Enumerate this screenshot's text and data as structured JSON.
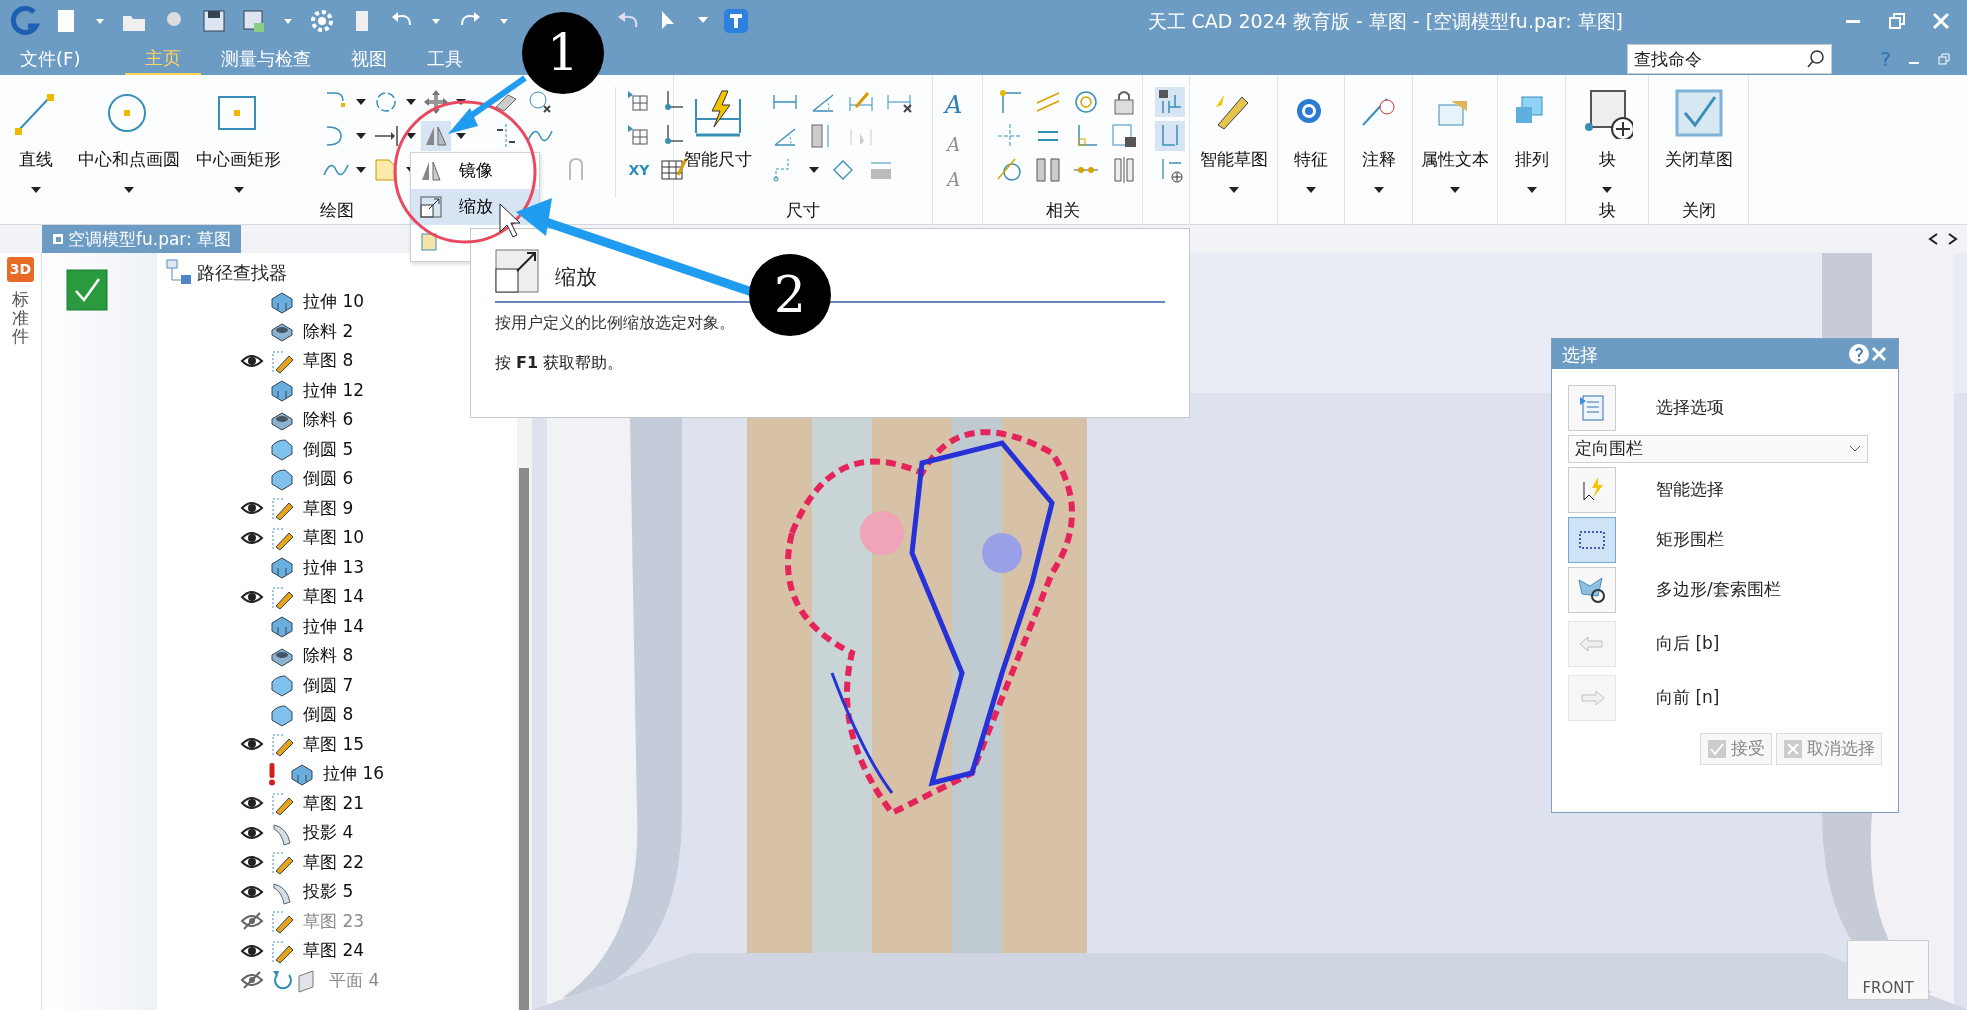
{
  "window": {
    "title": "天工 CAD 2024 教育版 - 草图 - [空调模型fu.par: 草图]"
  },
  "menu_tabs": [
    {
      "label": "文件(F)",
      "selected": false
    },
    {
      "label": "主页",
      "selected": true
    },
    {
      "label": "测量与检查",
      "selected": false
    },
    {
      "label": "视图",
      "selected": false
    },
    {
      "label": "工具",
      "selected": false
    }
  ],
  "search": {
    "placeholder": "查找命令"
  },
  "help_label": "?",
  "ribbon": [
    {
      "kind": "draw",
      "label": "绘图",
      "buttons": [
        {
          "label": "直线",
          "menu": true
        },
        {
          "label": "中心和点画圆",
          "menu": true
        },
        {
          "label": "中心画矩形",
          "menu": true
        }
      ],
      "xy_label": "XY"
    },
    {
      "kind": "dimension",
      "label": "尺寸",
      "buttons": [
        {
          "label": "智能尺寸",
          "menu": false
        }
      ]
    },
    {
      "kind": "text",
      "glyphs": [
        {
          "label": "A",
          "disabled": false
        },
        {
          "label": "A",
          "disabled": true
        },
        {
          "label": "A",
          "disabled": true
        }
      ]
    },
    {
      "kind": "relate",
      "label": "相关"
    },
    {
      "kind": "toggles"
    },
    {
      "kind": "plain",
      "buttons": [
        {
          "label": "智能草图",
          "menu": true
        }
      ]
    },
    {
      "kind": "plain",
      "buttons": [
        {
          "label": "特征",
          "menu": true
        }
      ]
    },
    {
      "kind": "plain",
      "buttons": [
        {
          "label": "注释",
          "menu": true
        }
      ]
    },
    {
      "kind": "plain",
      "buttons": [
        {
          "label": "属性文本",
          "menu": true
        }
      ]
    },
    {
      "kind": "plain",
      "buttons": [
        {
          "label": "排列",
          "menu": true
        }
      ]
    },
    {
      "kind": "plain",
      "label": "块",
      "buttons": [
        {
          "label": "块",
          "menu": true
        }
      ]
    },
    {
      "kind": "plain",
      "label": "关闭",
      "buttons": [
        {
          "label": "关闭草图",
          "menu": false
        }
      ]
    }
  ],
  "mirror_menu": {
    "items": [
      {
        "label": "镜像",
        "selected": false
      },
      {
        "label": "缩放",
        "selected": true
      }
    ]
  },
  "tooltip": {
    "title": "缩放",
    "description": "按用户定义的比例缩放选定对象。",
    "help": "按 **F1** 获取帮助。"
  },
  "callouts": [
    {
      "number": "1"
    },
    {
      "number": "2"
    }
  ],
  "doc_tab": {
    "label": "空调模型fu.par: 草图"
  },
  "side_strip": {
    "badge": "3D",
    "label": "标准件"
  },
  "tree": {
    "root": "路径查找器",
    "items": [
      {
        "label": "拉伸 10",
        "kind": "extrude",
        "error": false
      },
      {
        "label": "除料 2",
        "kind": "cut",
        "error": false
      },
      {
        "label": "草图 8",
        "kind": "sketch",
        "visible": true,
        "error": false
      },
      {
        "label": "拉伸 12",
        "kind": "extrude",
        "error": false
      },
      {
        "label": "除料 6",
        "kind": "cut",
        "error": false
      },
      {
        "label": "倒圆 5",
        "kind": "round",
        "error": false
      },
      {
        "label": "倒圆 6",
        "kind": "round",
        "error": false
      },
      {
        "label": "草图 9",
        "kind": "sketch",
        "visible": true,
        "error": false
      },
      {
        "label": "草图 10",
        "kind": "sketch",
        "visible": true,
        "error": false
      },
      {
        "label": "拉伸 13",
        "kind": "extrude",
        "error": false
      },
      {
        "label": "草图 14",
        "kind": "sketch",
        "visible": true,
        "error": false
      },
      {
        "label": "拉伸 14",
        "kind": "extrude",
        "error": false
      },
      {
        "label": "除料 8",
        "kind": "cut",
        "error": false
      },
      {
        "label": "倒圆 7",
        "kind": "round",
        "error": false
      },
      {
        "label": "倒圆 8",
        "kind": "round",
        "error": false
      },
      {
        "label": "草图 15",
        "kind": "sketch",
        "visible": true,
        "error": false,
        "children": [
          {
            "label": "拉伸 16",
            "kind": "extrude",
            "error": true
          }
        ]
      },
      {
        "label": "草图 21",
        "kind": "sketch",
        "visible": true,
        "error": false
      },
      {
        "label": "投影 4",
        "kind": "projection",
        "visible": true,
        "error": false
      },
      {
        "label": "草图 22",
        "kind": "sketch",
        "visible": true,
        "error": false
      },
      {
        "label": "投影 5",
        "kind": "projection",
        "visible": true,
        "error": false
      },
      {
        "label": "草图 23",
        "kind": "sketch",
        "visible": false,
        "error": false
      },
      {
        "label": "草图 24",
        "kind": "sketch",
        "visible": true,
        "error": false
      },
      {
        "label": "平面 4",
        "kind": "plane",
        "visible": false,
        "error": false
      }
    ]
  },
  "select_panel": {
    "title": "选择",
    "options_label": "选择选项",
    "fence_value": "定向围栏",
    "tools": [
      {
        "label": "智能选择",
        "selected": false,
        "disabled": false
      },
      {
        "label": "矩形围栏",
        "selected": true,
        "disabled": false
      },
      {
        "label": "多边形/套索围栏",
        "selected": false,
        "disabled": false
      },
      {
        "label": "向后 [b]",
        "selected": false,
        "disabled": true
      },
      {
        "label": "向前 [n]",
        "selected": false,
        "disabled": true
      }
    ],
    "buttons": [
      {
        "label": "接受",
        "disabled": true
      },
      {
        "label": "取消选择",
        "disabled": true
      }
    ]
  },
  "view_cube": {
    "label": "FRONT"
  }
}
